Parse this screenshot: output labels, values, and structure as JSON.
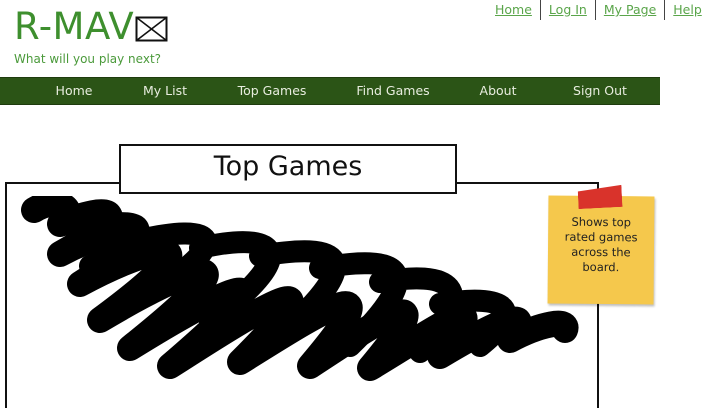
{
  "header": {
    "logo_text": "R-MAV",
    "logo_icon": "broken-image-icon",
    "tagline": "What will you play next?"
  },
  "top_links": [
    {
      "label": "Home"
    },
    {
      "label": "Log In"
    },
    {
      "label": "My Page"
    },
    {
      "label": "Help"
    }
  ],
  "nav": {
    "items": [
      {
        "label": "Home"
      },
      {
        "label": "My List"
      },
      {
        "label": "Top Games"
      },
      {
        "label": "Find Games"
      },
      {
        "label": "About"
      },
      {
        "label": "Sign Out"
      }
    ]
  },
  "panel": {
    "title": "Top Games"
  },
  "sticky_note": {
    "text": "Shows top rated games across the board."
  },
  "colors": {
    "brand_green": "#3e8f2e",
    "nav_bg": "#2b5416",
    "link_green": "#5aa54a",
    "sticky_yellow": "#f5c84c",
    "tape_red": "#d9332b"
  }
}
